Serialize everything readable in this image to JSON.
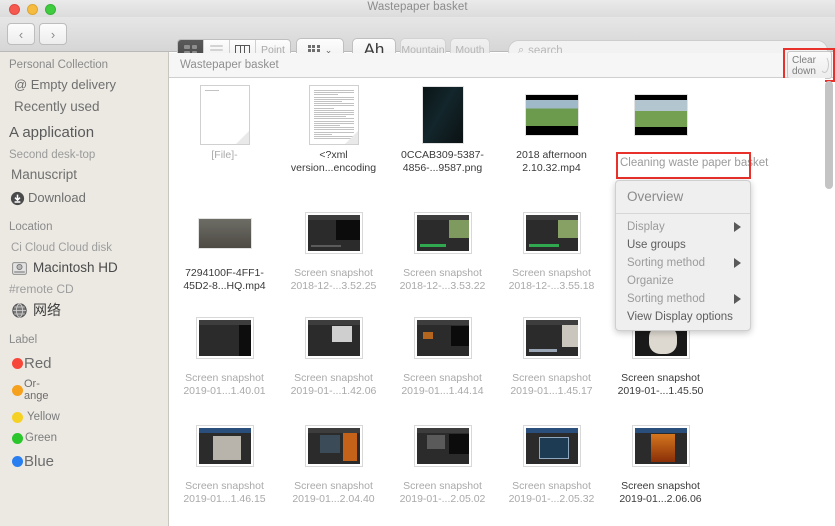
{
  "window": {
    "title": "Wastepaper basket"
  },
  "titlebar": {
    "close_label": "close",
    "minimize_label": "minimize",
    "zoom_label": "zoom"
  },
  "toolbar": {
    "back_glyph": "‹",
    "forward_glyph": "›",
    "view_modes": [
      {
        "name": "icon-view",
        "label": "",
        "selected": true
      },
      {
        "name": "list-view",
        "label": "",
        "selected": false
      },
      {
        "name": "column-view",
        "label": "",
        "selected": false
      },
      {
        "name": "coverflow-view",
        "label": "Point",
        "selected": false
      }
    ],
    "arrange_label": "",
    "chevron_glyph": "⌄",
    "action_label": "Ah",
    "mountain_label": "Mountain",
    "mouth_label": "Mouth",
    "search": {
      "placeholder": "search",
      "value": "",
      "icon_glyph": "⌕"
    }
  },
  "pathbar": {
    "label": "Wastepaper basket"
  },
  "cleardown": {
    "line1": "Clear",
    "line2": "down"
  },
  "sidebar": {
    "sections": [
      {
        "heading": "Personal Collection",
        "items": [
          {
            "label": "@ Empty delivery",
            "icon": "trash-icon",
            "size": 13
          },
          {
            "label": "Recently used",
            "icon": "clock-icon",
            "size": 13.5
          },
          {
            "label": "A application",
            "icon": "apps-icon",
            "size": 15
          },
          {
            "label": "Second desk-top",
            "icon": "desktop-icon",
            "size": 11.5
          },
          {
            "label": "Manuscript",
            "icon": "document-icon",
            "size": 13.5
          },
          {
            "label": "Download",
            "icon": "download-icon",
            "size": 13
          }
        ]
      },
      {
        "heading": "Location",
        "items": [
          {
            "label": "Ci Cloud Cloud disk",
            "icon": "cloud-icon",
            "size": 11.5
          },
          {
            "label": "Macintosh HD",
            "icon": "harddisk-icon",
            "size": 13.5
          },
          {
            "label": "#remote CD",
            "icon": "disc-icon",
            "size": 12
          },
          {
            "label": "网络",
            "icon": "network-icon",
            "size": 14
          }
        ]
      },
      {
        "heading": "Label",
        "items": [
          {
            "label": "Red",
            "color": "#f6473a",
            "size": 15
          },
          {
            "label": "Or-ange",
            "color": "#f5a11e",
            "size": 11
          },
          {
            "label": "Yellow",
            "color": "#f5d123",
            "size": 11.5
          },
          {
            "label": "Green",
            "color": "#2bc62b",
            "size": 11.5
          },
          {
            "label": "Blue",
            "color": "#2a7ff0",
            "size": 15
          }
        ]
      }
    ]
  },
  "files": {
    "rows": [
      [
        {
          "name": "[File]-",
          "thumb": "blank-document",
          "faded": true
        },
        {
          "name": "<?xml version...encoding",
          "thumb": "text-document",
          "faded": false
        },
        {
          "name": "0CCAB309-5387-4856-...9587.png",
          "thumb": "dark-image",
          "faded": false
        },
        {
          "name": "2018 afternoon 2.10.32.mp4",
          "thumb": "outdoor-video",
          "faded": false
        },
        {
          "name": "",
          "thumb": "tree-video",
          "faded": false
        }
      ],
      [
        {
          "name": "7294100F-4FF1-45D2-8...HQ.mp4",
          "thumb": "person-video",
          "faded": false
        },
        {
          "name": "Screen snapshot 2018-12-...3.52.25",
          "thumb": "screenshot-dark",
          "faded": true
        },
        {
          "name": "Screen snapshot 2018-12-...3.53.22",
          "thumb": "screenshot-green",
          "faded": true
        },
        {
          "name": "Screen snapshot 2018-12-...3.55.18",
          "thumb": "screenshot-green",
          "faded": true
        },
        {
          "name": "",
          "thumb": "screenshot-dark",
          "faded": true
        }
      ],
      [
        {
          "name": "Screen snapshot 2019-01...1.40.01",
          "thumb": "screenshot-dark",
          "faded": true
        },
        {
          "name": "Screen snapshot 2019-01-...1.42.06",
          "thumb": "screenshot-editor",
          "faded": true
        },
        {
          "name": "Screen snapshot 2019-01...1.44.14",
          "thumb": "screenshot-dark",
          "faded": true
        },
        {
          "name": "Screen snapshot 2019-01...1.45.17",
          "thumb": "screenshot-text",
          "faded": true
        },
        {
          "name": "Screen snapshot 2019-01-...1.45.50",
          "thumb": "screenshot-light",
          "faded": false
        }
      ],
      [
        {
          "name": "Screen snapshot 2019-01...1.46.15",
          "thumb": "screenshot-editor",
          "faded": true
        },
        {
          "name": "Screen snapshot 2019-01...2.04.40",
          "thumb": "screenshot-fire",
          "faded": true
        },
        {
          "name": "Screen snapshot 2019-01-...2.05.02",
          "thumb": "screenshot-dark",
          "faded": true
        },
        {
          "name": "Screen snapshot 2019-01-...2.05.32",
          "thumb": "screenshot-dark",
          "faded": true
        },
        {
          "name": "Screen snapshot 2019-01...2.06.06",
          "thumb": "screenshot-fire",
          "faded": false
        }
      ]
    ]
  },
  "context_menu": {
    "title": "Cleaning waste paper basket",
    "items": [
      {
        "label": "Overview",
        "submenu": false,
        "style": "big"
      },
      {
        "label": "Display",
        "submenu": true,
        "style": "normal"
      },
      {
        "label": "Use groups",
        "submenu": false,
        "style": "strong"
      },
      {
        "label": "Sorting method",
        "submenu": true,
        "style": "normal"
      },
      {
        "label": "Organize",
        "submenu": false,
        "style": "normal"
      },
      {
        "label": "Sorting method",
        "submenu": true,
        "style": "normal"
      },
      {
        "label": "View Display options",
        "submenu": false,
        "style": "strong"
      }
    ]
  },
  "annotations": {
    "highlight_color": "#e8312a",
    "boxes": [
      "cleaning-waste-paper-basket",
      "clear-down-button"
    ]
  }
}
